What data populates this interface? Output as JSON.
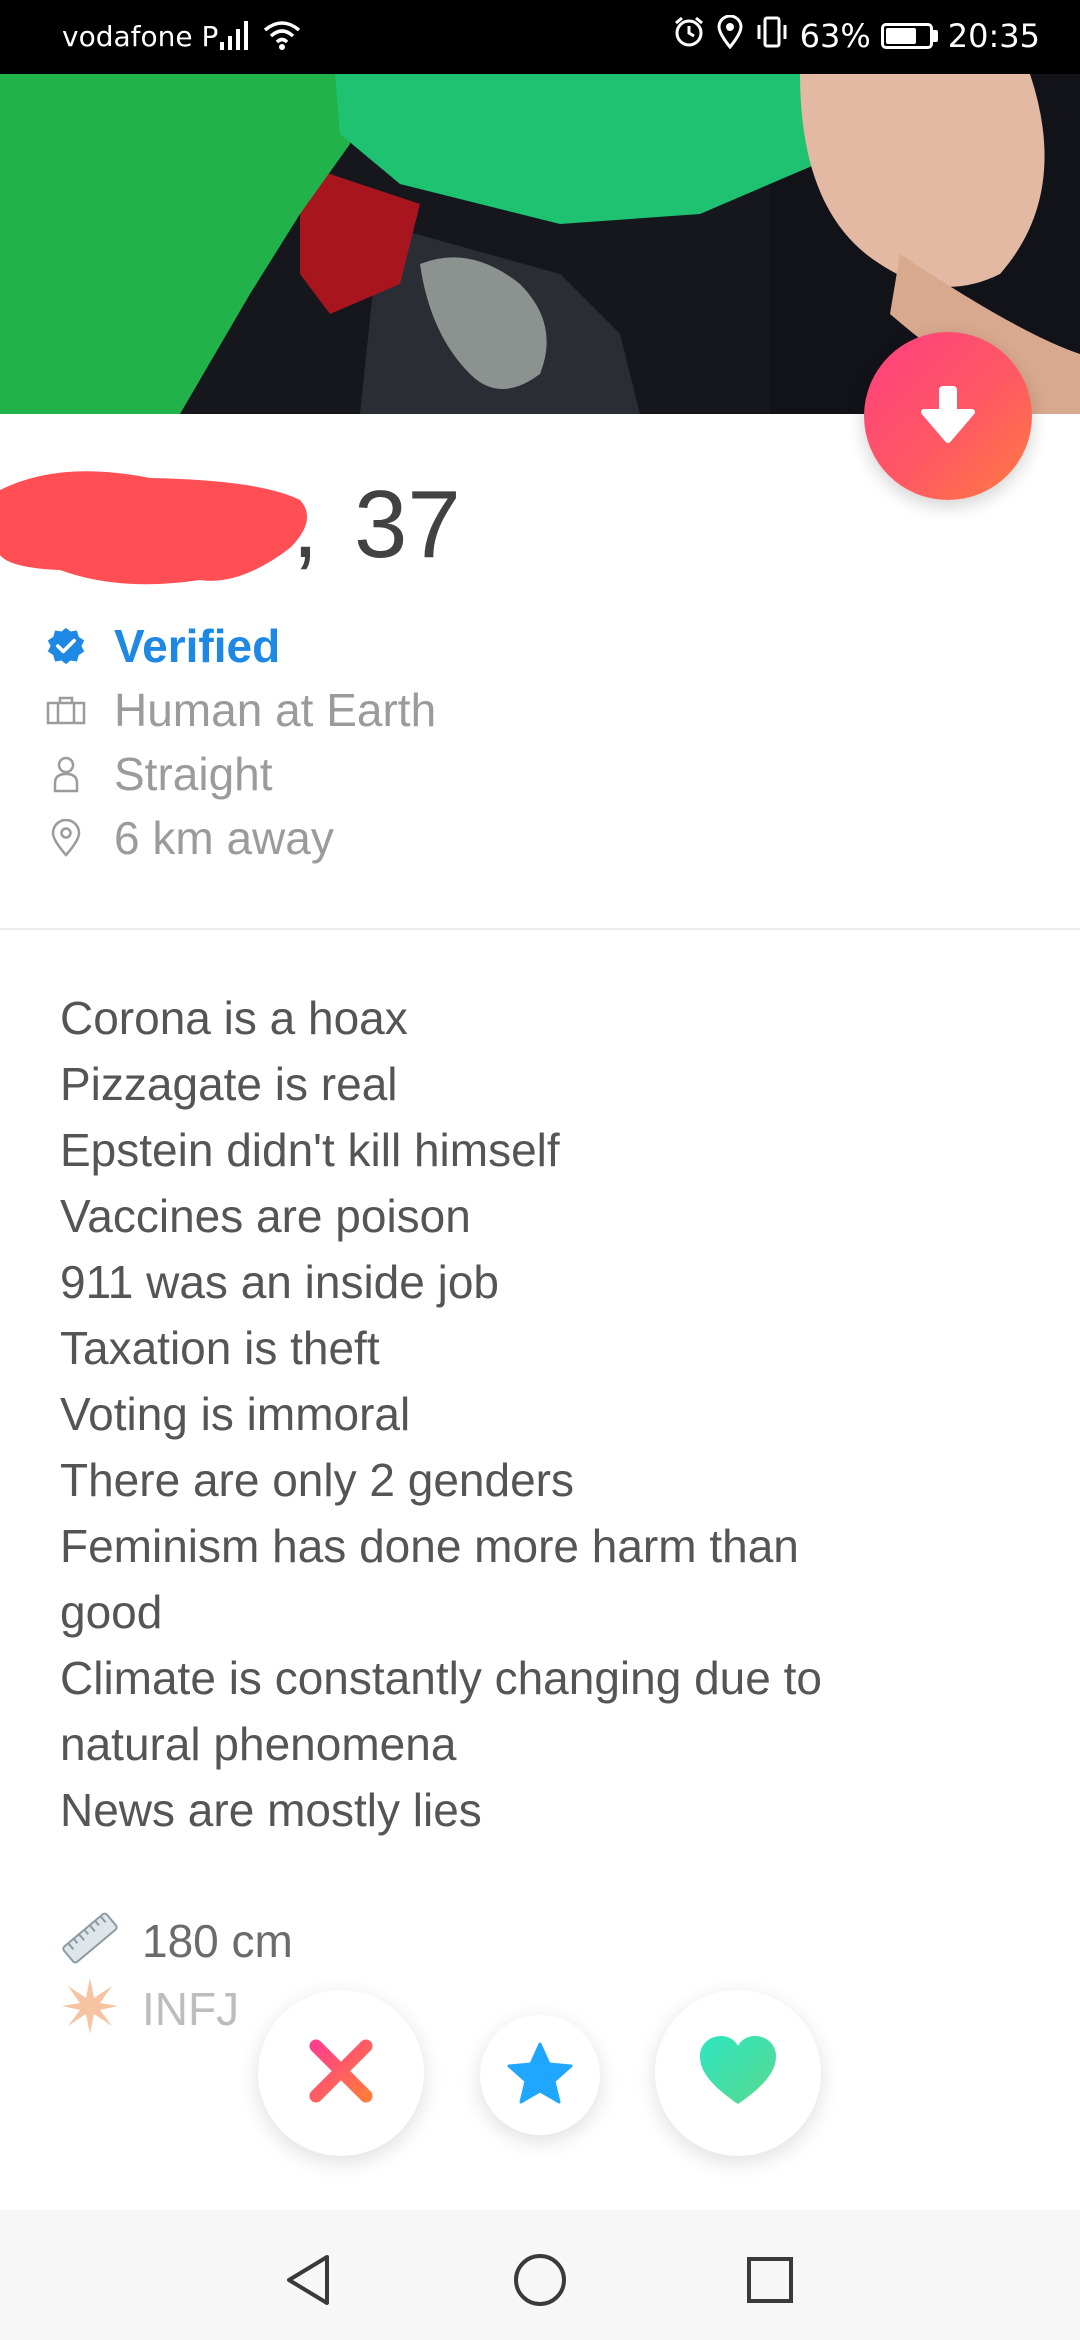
{
  "status_bar": {
    "carrier": "vodafone P",
    "battery_percent": "63%",
    "time": "20:35",
    "icons": [
      "signal-icon",
      "wifi-icon",
      "alarm-icon",
      "location-icon",
      "vibrate-icon",
      "battery-icon"
    ]
  },
  "photo": {
    "description": "profile-photo"
  },
  "profile": {
    "name_redacted": true,
    "comma": ",",
    "age": "37",
    "verified_label": "Verified",
    "job": "Human at Earth",
    "orientation": "Straight",
    "distance": "6 km away"
  },
  "bio": {
    "lines": [
      "Corona is a hoax",
      "Pizzagate is real",
      "Epstein didn't kill himself",
      "Vaccines are poison",
      "911 was an inside job",
      "Taxation is theft",
      "Voting is immoral",
      "There are only 2 genders",
      "Feminism has done more harm than",
      "good",
      "Climate is constantly changing due to",
      "natural phenomena",
      "News are mostly lies"
    ]
  },
  "extras": {
    "height": "180 cm",
    "personality": "INFJ"
  },
  "actions": {
    "nope_icon": "close-icon",
    "superlike_icon": "star-icon",
    "like_icon": "heart-icon",
    "info_icon": "arrow-down-icon"
  },
  "colors": {
    "verified_blue": "#1e88e5",
    "like_gradient_start": "#ff3f7f",
    "like_gradient_end": "#ff7c3f",
    "nope": "#ff4a6b",
    "superlike": "#1fa6ff",
    "like": "#3fdcbd"
  }
}
